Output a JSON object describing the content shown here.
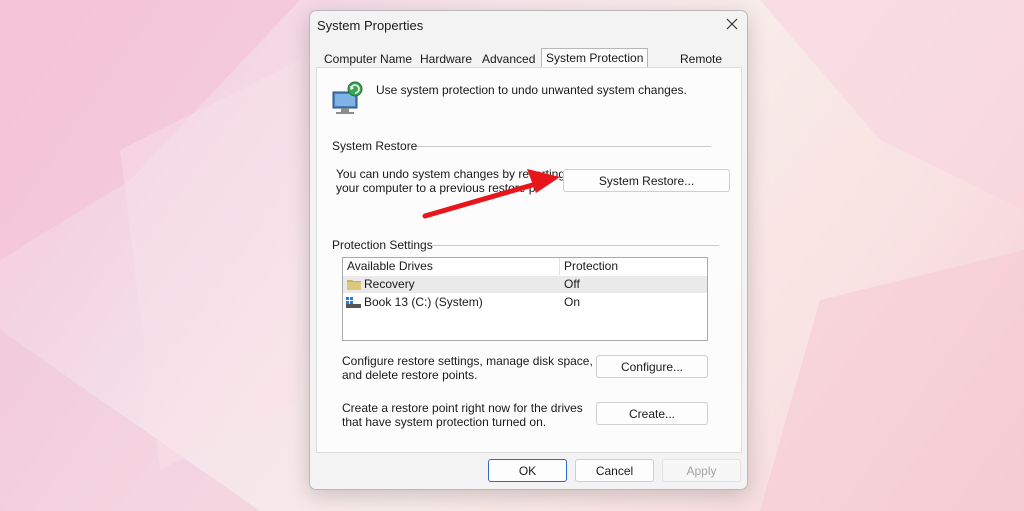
{
  "window": {
    "title": "System Properties"
  },
  "tabs": [
    {
      "label": "Computer Name"
    },
    {
      "label": "Hardware"
    },
    {
      "label": "Advanced"
    },
    {
      "label": "System Protection"
    },
    {
      "label": "Remote"
    }
  ],
  "active_tab": "System Protection",
  "intro_text": "Use system protection to undo unwanted system changes.",
  "restore_group": {
    "title": "System Restore",
    "line1": "You can undo system changes by reverting",
    "line2": "your computer to a previous restore p",
    "button": "System Restore..."
  },
  "protection_group": {
    "title": "Protection Settings",
    "columns": [
      "Available Drives",
      "Protection"
    ],
    "drives": [
      {
        "name": "Recovery",
        "protection": "Off",
        "icon": "folder-icon",
        "selected": true
      },
      {
        "name": "Book 13 (C:) (System)",
        "protection": "On",
        "icon": "system-drive-icon",
        "selected": false
      }
    ],
    "configure_line1": "Configure restore settings, manage disk space,",
    "configure_line2": "and delete restore points.",
    "configure_button": "Configure...",
    "create_line1": "Create a restore point right now for the drives",
    "create_line2": "that have system protection turned on.",
    "create_button": "Create..."
  },
  "footer": {
    "ok": "OK",
    "cancel": "Cancel",
    "apply": "Apply"
  },
  "colors": {
    "arrow": "#e8161b",
    "primary_border": "#2a6bbf"
  }
}
